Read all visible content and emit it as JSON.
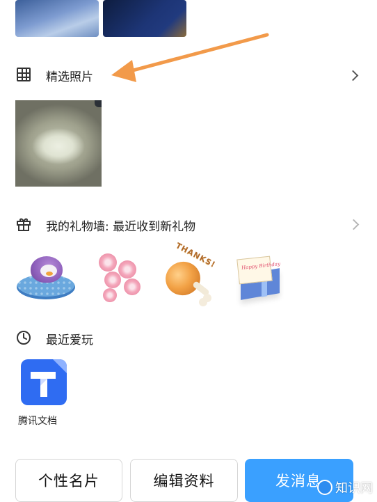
{
  "featured_photos": {
    "title": "精选照片"
  },
  "gift_wall": {
    "title": "我的礼物墙: 最近收到新礼物",
    "items": [
      {
        "name": "penguin-float-gift"
      },
      {
        "name": "cherry-blossom-gift"
      },
      {
        "name": "drumstick-thanks-gift",
        "sticker_text": "THANKS!"
      },
      {
        "name": "birthday-card-gift",
        "sticker_text": "Happy Birthday"
      }
    ]
  },
  "recent_play": {
    "title": "最近爱玩",
    "apps": [
      {
        "label": "腾讯文档",
        "icon": "tencent-docs-icon",
        "color": "#2f6cf2"
      }
    ]
  },
  "actions": {
    "business_card": "个性名片",
    "edit_profile": "编辑资料",
    "send_message": "发消息"
  },
  "watermark": {
    "text": "知识网"
  },
  "colors": {
    "primary": "#3aa0ff",
    "arrow": "#f29a4a"
  }
}
